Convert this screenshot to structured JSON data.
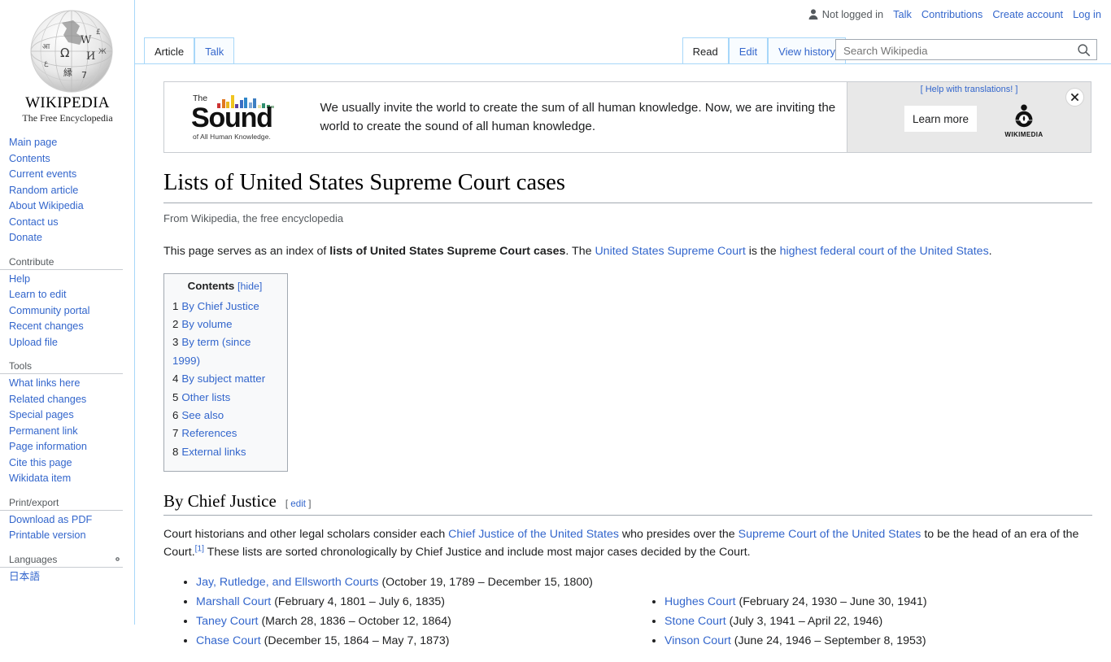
{
  "site": {
    "wordmark": "WIKIPEDIA",
    "tagline": "The Free Encyclopedia",
    "logo_icon": "wikipedia-globe-icon"
  },
  "personal_bar": {
    "user_icon": "user-icon",
    "not_logged_in": "Not logged in",
    "links": [
      "Talk",
      "Contributions",
      "Create account",
      "Log in"
    ]
  },
  "tabs": {
    "namespaces": [
      {
        "label": "Article",
        "selected": true
      },
      {
        "label": "Talk",
        "selected": false
      }
    ],
    "views": [
      {
        "label": "Read",
        "selected": true
      },
      {
        "label": "Edit",
        "selected": false
      },
      {
        "label": "View history",
        "selected": false
      }
    ]
  },
  "search": {
    "placeholder": "Search Wikipedia",
    "value": "",
    "icon": "search-icon"
  },
  "sidebar": {
    "sections": [
      {
        "heading": "",
        "items": [
          "Main page",
          "Contents",
          "Current events",
          "Random article",
          "About Wikipedia",
          "Contact us",
          "Donate"
        ]
      },
      {
        "heading": "Contribute",
        "items": [
          "Help",
          "Learn to edit",
          "Community portal",
          "Recent changes",
          "Upload file"
        ]
      },
      {
        "heading": "Tools",
        "items": [
          "What links here",
          "Related changes",
          "Special pages",
          "Permanent link",
          "Page information",
          "Cite this page",
          "Wikidata item"
        ]
      },
      {
        "heading": "Print/export",
        "items": [
          "Download as PDF",
          "Printable version"
        ]
      },
      {
        "heading": "Languages",
        "items": [
          "日本語"
        ],
        "gear_icon": "gear-icon"
      }
    ]
  },
  "banner": {
    "logo": {
      "the": "The",
      "word": "Sound",
      "subtitle": "of All Human Knowledge.",
      "bar_colors": [
        "#cc3333",
        "#e07820",
        "#e8b820",
        "#f0c420",
        "#5b3fa0",
        "#3a6fc4",
        "#2f86c9",
        "#7fa9d8",
        "#3e7fc1",
        "#e6e0a8",
        "#2f8f6f",
        "#3d8f5a",
        "#8fb89a"
      ]
    },
    "message": "We usually invite the world to create the sum of all human knowledge. Now, we are inviting the world to create the sound of all human knowledge.",
    "help_translations": "[ Help with translations! ]",
    "learn_more": "Learn more",
    "wikimedia_label": "WIKIMEDIA",
    "wikimedia_icon": "wikimedia-logo-icon",
    "close_icon": "close-icon"
  },
  "article": {
    "title": "Lists of United States Supreme Court cases",
    "site_sub": "From Wikipedia, the free encyclopedia",
    "lead": {
      "part1": "This page serves as an index of ",
      "bold": "lists of United States Supreme Court cases",
      "part2": ". The ",
      "link1": "United States Supreme Court",
      "part3": " is the ",
      "link2": "highest federal court of the United States",
      "part4": "."
    }
  },
  "toc": {
    "title": "Contents",
    "toggle": "[hide]",
    "items": [
      {
        "num": "1",
        "label": "By Chief Justice"
      },
      {
        "num": "2",
        "label": "By volume"
      },
      {
        "num": "3",
        "label": "By term (since 1999)"
      },
      {
        "num": "4",
        "label": "By subject matter"
      },
      {
        "num": "5",
        "label": "Other lists"
      },
      {
        "num": "6",
        "label": "See also"
      },
      {
        "num": "7",
        "label": "References"
      },
      {
        "num": "8",
        "label": "External links"
      }
    ]
  },
  "section": {
    "heading": "By Chief Justice",
    "edit_open": "[",
    "edit_label": "edit",
    "edit_close": "]",
    "para": {
      "part1": "Court historians and other legal scholars consider each ",
      "link1": "Chief Justice of the United States",
      "part2": " who presides over the ",
      "link2": "Supreme Court of the United States",
      "part3": " to be the head of an era of the Court.",
      "ref": "[1]",
      "part4": " These lists are sorted chronologically by Chief Justice and include most major cases decided by the Court."
    },
    "courts_left": [
      {
        "name": "Jay, Rutledge, and Ellsworth Courts",
        "dates": "(October 19, 1789 – December 15, 1800)"
      },
      {
        "name": "Marshall Court",
        "dates": "(February 4, 1801 – July 6, 1835)"
      },
      {
        "name": "Taney Court",
        "dates": "(March 28, 1836 – October 12, 1864)"
      },
      {
        "name": "Chase Court",
        "dates": "(December 15, 1864 – May 7, 1873)"
      }
    ],
    "courts_right": [
      {
        "name": "Hughes Court",
        "dates": "(February 24, 1930 – June 30, 1941)"
      },
      {
        "name": "Stone Court",
        "dates": "(July 3, 1941 – April 22, 1946)"
      },
      {
        "name": "Vinson Court",
        "dates": "(June 24, 1946 – September 8, 1953)"
      }
    ]
  },
  "colors": {
    "link": "#3366cc",
    "border": "#a7d7f9",
    "text": "#202122"
  }
}
